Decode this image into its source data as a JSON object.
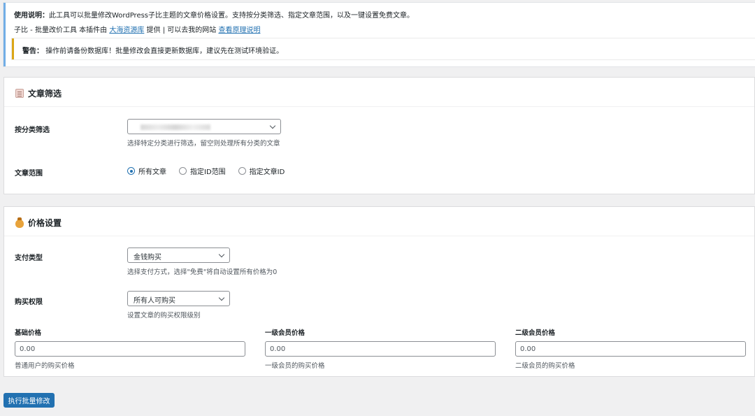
{
  "notice": {
    "usage_label": "使用说明：",
    "usage_text": "此工具可以批量修改WordPress子比主题的文章价格设置。支持按分类筛选、指定文章范围，以及一键设置免费文章。",
    "credit_prefix": "子比 - 批量改价工具 本插件由",
    "credit_link": "大海资源库",
    "credit_mid": "提供 | 可以去我的网站",
    "credit_link2": "查看原理说明",
    "warning_label": "警告：",
    "warning_text": "操作前请备份数据库！批量修改会直接更新数据库，建议先在测试环境验证。"
  },
  "filter_card": {
    "title": "文章筛选",
    "category_label": "按分类筛选",
    "category_help": "选择特定分类进行筛选，留空则处理所有分类的文章",
    "range_label": "文章范围",
    "range_options": [
      "所有文章",
      "指定ID范围",
      "指定文章ID"
    ],
    "range_selected": 0
  },
  "price_card": {
    "title": "价格设置",
    "pay_type_label": "支付类型",
    "pay_type_value": "金钱购买",
    "pay_type_help": "选择支付方式，选择\"免费\"将自动设置所有价格为0",
    "perm_label": "购买权限",
    "perm_value": "所有人可购买",
    "perm_help": "设置文章的购买权限级别",
    "prices": [
      {
        "label": "基础价格",
        "value": "0.00",
        "help": "普通用户的购买价格"
      },
      {
        "label": "一级会员价格",
        "value": "0.00",
        "help": "一级会员的购买价格"
      },
      {
        "label": "二级会员价格",
        "value": "0.00",
        "help": "二级会员的购买价格"
      }
    ]
  },
  "submit_label": "执行批量修改",
  "colors": {
    "primary": "#2271b1",
    "warning": "#dba617",
    "info": "#72aee6"
  }
}
